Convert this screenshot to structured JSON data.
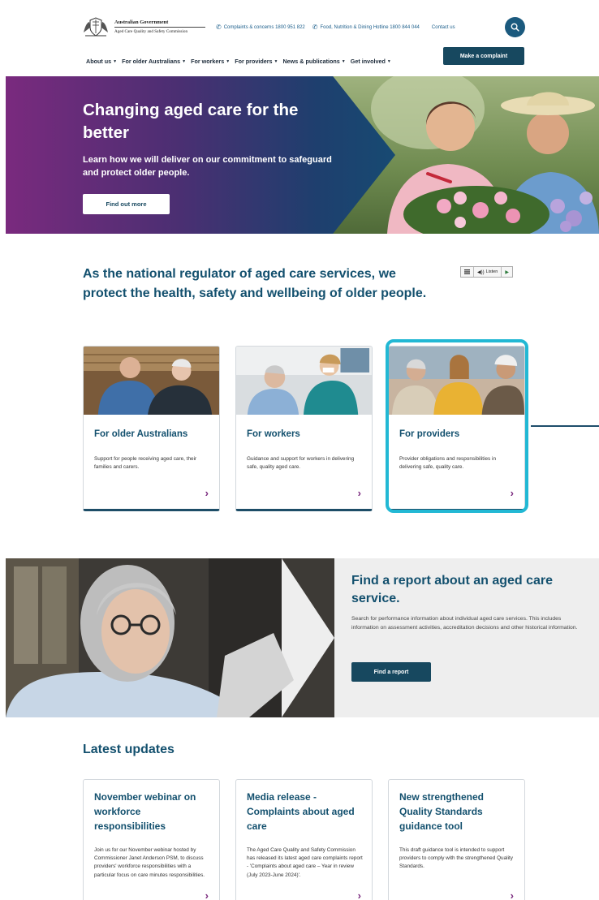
{
  "header": {
    "logo": {
      "government": "Australian Government",
      "commission": "Aged Care Quality and Safety Commission"
    },
    "top_links": [
      {
        "label": "Complaints & concerns 1800 951 822",
        "icon": "phone-icon"
      },
      {
        "label": "Food, Nutrition & Dining Hotline 1800 844 044",
        "icon": "phone-icon"
      },
      {
        "label": "Contact us"
      }
    ],
    "search_icon": "search-icon",
    "nav": [
      {
        "label": "About us"
      },
      {
        "label": "For older Australians"
      },
      {
        "label": "For workers"
      },
      {
        "label": "For providers"
      },
      {
        "label": "News & publications"
      },
      {
        "label": "Get involved"
      }
    ],
    "cta_label": "Make a complaint"
  },
  "hero": {
    "title": "Changing aged care for the better",
    "subtitle": "Learn how we will deliver on our commitment to safeguard and protect older people.",
    "button_label": "Find out more"
  },
  "intro": {
    "heading": "As the national regulator of aged care services, we protect the health, safety and wellbeing of older people.",
    "listen_label": "Listen"
  },
  "cards": [
    {
      "title": "For older Australians",
      "description": "Support for people receiving aged care, their families and carers."
    },
    {
      "title": "For workers",
      "description": "Guidance and support for workers in delivering safe, quality aged care."
    },
    {
      "title": "For providers",
      "description": "Provider obligations and responsibilities in delivering safe, quality care."
    }
  ],
  "report": {
    "title": "Find a report about an aged care service.",
    "description": "Search for performance information about individual aged care services. This includes information on assessment activities, accreditation decisions and other historical information.",
    "button_label": "Find a report"
  },
  "updates": {
    "heading": "Latest updates",
    "items": [
      {
        "title": "November webinar on workforce responsibilities",
        "description": "Join us for our November webinar hosted by Commissioner Janet Anderson PSM, to discuss providers' workforce responsibilities with a particular focus on care minutes responsibilities."
      },
      {
        "title": "Media release - Complaints about aged care",
        "description": "The Aged Care Quality and Safety Commission has released its latest aged care complaints report - 'Complaints about aged care – Year in review (July 2023-June 2024)'."
      },
      {
        "title": "New strengthened Quality Standards guidance tool",
        "description": "This draft guidance tool is intended to support providers to comply with the strengthened Quality Standards."
      }
    ]
  },
  "colors": {
    "primary": "#13506e",
    "button_dark": "#17485f",
    "hero_purple": "#7a2a7e",
    "highlight": "#22b8d4"
  }
}
